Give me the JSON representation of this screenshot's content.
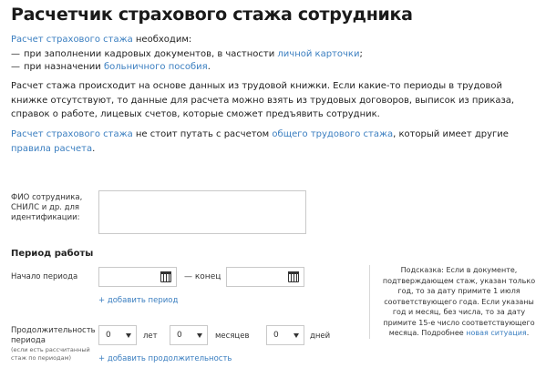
{
  "title": "Расчетчик страхового стажа сотрудника",
  "intro": {
    "link": "Расчет страхового стажа",
    "text": " необходим:"
  },
  "bullets": [
    {
      "dash": "—",
      "text": "при заполнении кадровых документов, в частности ",
      "link": "личной карточки",
      "tail": ";"
    },
    {
      "dash": "—",
      "text": "при назначении ",
      "link": "больничного пособия",
      "tail": "."
    }
  ],
  "paragraph2": "Расчет стажа происходит на основе данных из трудовой книжки. Если какие-то периоды в трудовой книжке отсутствуют, то данные для расчета можно взять из трудовых договоров, выписок из приказа, справок о работе, лицевых счетов, которые сможет предъявить сотрудник.",
  "paragraph3": {
    "link1": "Расчет страхового стажа",
    "text1": " не стоит путать с расчетом ",
    "link2": "общего трудового стажа",
    "text2": ", который имеет другие ",
    "link3": "правила расчета",
    "text3": "."
  },
  "form": {
    "fio_label": "ФИО сотрудника, СНИЛС и др. для идентификации:",
    "fio_value": "",
    "section_title": "Период работы",
    "start_label": "Начало периода",
    "end_label": "— конец",
    "start_value": "",
    "end_value": "",
    "add_period": "+ добавить период",
    "duration_label": "Продолжительность периода",
    "duration_note": "(если есть рассчитанный стаж по периодам)",
    "years_value": "0",
    "years_unit": "лет",
    "months_value": "0",
    "months_unit": "месяцев",
    "days_value": "0",
    "days_unit": "дней",
    "add_duration": "+ добавить продолжительность"
  },
  "hint": {
    "text": "Подсказка: Если в документе, подтверждающем стаж, указан только год, то за дату примите 1 июля соответствующего года. Если указаны год и месяц, без числа, то за дату примите 15-е число соответствующего месяца. Подробнее ",
    "link": "новая ситуация",
    "tail": "."
  },
  "icons": {
    "calendar": "calendar-icon",
    "dropdown": "chevron-down-icon"
  },
  "colors": {
    "link": "#3a7ec0",
    "text": "#222222",
    "border": "#c9c9c9"
  }
}
